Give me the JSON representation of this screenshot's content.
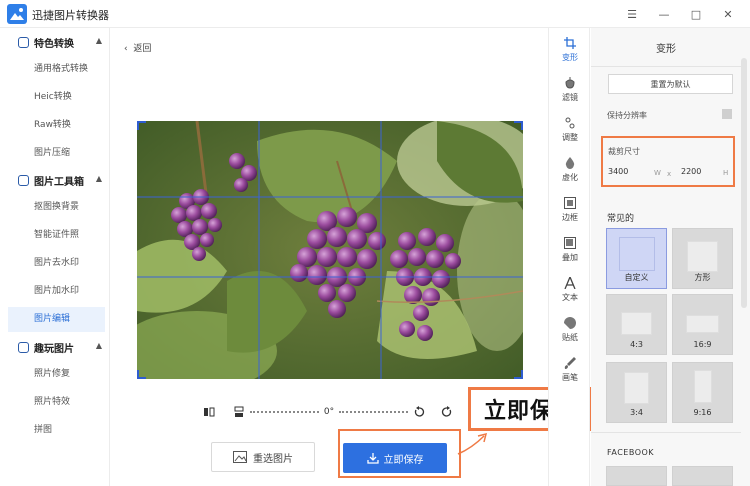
{
  "app": {
    "title": "迅捷图片转换器",
    "window_controls": [
      "☰",
      "—",
      "□",
      "✕"
    ]
  },
  "sidebar": {
    "sections": [
      {
        "label": "特色转换",
        "items": [
          "通用格式转换",
          "Heic转换",
          "Raw转换",
          "图片压缩"
        ]
      },
      {
        "label": "图片工具箱",
        "items": [
          "抠图换背景",
          "智能证件照",
          "图片去水印",
          "图片加水印",
          "图片编辑"
        ]
      },
      {
        "label": "趣玩图片",
        "items": [
          "照片修复",
          "照片特效",
          "拼图"
        ]
      }
    ],
    "active_item": "图片编辑"
  },
  "editor": {
    "back_label": "返回",
    "rotation_angle": "0°",
    "reselect_label": "重选图片",
    "save_label": "立即保存",
    "callout_text": "立即保存"
  },
  "tools": [
    {
      "label": "变形",
      "icon": "crop-icon"
    },
    {
      "label": "滤镜",
      "icon": "filter-icon"
    },
    {
      "label": "调整",
      "icon": "adjust-icon"
    },
    {
      "label": "虚化",
      "icon": "blur-icon"
    },
    {
      "label": "边框",
      "icon": "frame-icon"
    },
    {
      "label": "叠加",
      "icon": "overlay-icon"
    },
    {
      "label": "文本",
      "icon": "text-icon"
    },
    {
      "label": "贴纸",
      "icon": "sticker-icon"
    },
    {
      "label": "画笔",
      "icon": "brush-icon"
    }
  ],
  "panel": {
    "title": "变形",
    "reset_label": "重置为默认",
    "keep_resolution_label": "保持分辨率",
    "crop_size_label": "裁剪尺寸",
    "width": "3400",
    "width_unit": "W",
    "times": "x",
    "height": "2200",
    "height_unit": "H",
    "common_label": "常见的",
    "ratios": [
      "自定义",
      "方形",
      "4:3",
      "16:9",
      "3:4",
      "9:16"
    ],
    "facebook_label": "FACEBOOK"
  },
  "colors": {
    "accent": "#2d70e0",
    "highlight": "#ef7a45",
    "selected_ratio": "#cfd6f5"
  }
}
